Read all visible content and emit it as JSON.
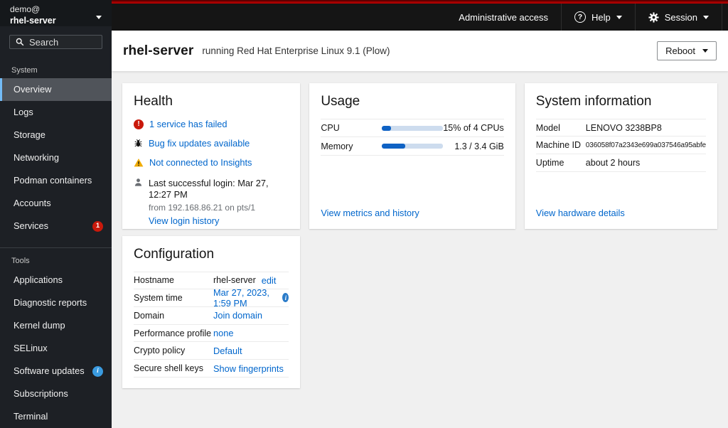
{
  "colors": {
    "brand_red": "#c40000",
    "link_blue": "#0066cc",
    "danger_red": "#c9190b",
    "warning_yellow": "#f0ab00",
    "info_blue": "#2b7cc9",
    "nav_active_accent": "#73bcf7"
  },
  "masthead": {
    "user": "demo@",
    "host": "rhel-server",
    "admin_access_label": "Administrative access",
    "help_label": "Help",
    "session_label": "Session"
  },
  "sidebar": {
    "search_placeholder": "Search",
    "sections": [
      {
        "label": "System",
        "items": [
          {
            "label": "Overview"
          },
          {
            "label": "Logs"
          },
          {
            "label": "Storage"
          },
          {
            "label": "Networking"
          },
          {
            "label": "Podman containers"
          },
          {
            "label": "Accounts"
          },
          {
            "label": "Services",
            "badge": "1"
          }
        ]
      },
      {
        "label": "Tools",
        "items": [
          {
            "label": "Applications"
          },
          {
            "label": "Diagnostic reports"
          },
          {
            "label": "Kernel dump"
          },
          {
            "label": "SELinux"
          },
          {
            "label": "Software updates",
            "badge": "i"
          },
          {
            "label": "Subscriptions"
          },
          {
            "label": "Terminal"
          }
        ]
      }
    ]
  },
  "page_header": {
    "title": "rhel-server",
    "subtitle": "running Red Hat Enterprise Linux 9.1 (Plow)",
    "reboot_label": "Reboot"
  },
  "health": {
    "title": "Health",
    "alerts": [
      {
        "icon": "exclamation-circle-icon",
        "text": "1 service has failed"
      },
      {
        "icon": "bug-icon",
        "text": "Bug fix updates available"
      },
      {
        "icon": "warning-triangle-icon",
        "text": "Not connected to Insights"
      }
    ],
    "last_login": {
      "icon": "user-icon",
      "text": "Last successful login: Mar 27, 12:27 PM",
      "detail": "from 192.168.86.21 on pts/1",
      "link": "View login history"
    }
  },
  "usage": {
    "title": "Usage",
    "rows": [
      {
        "label": "CPU",
        "percent": 15,
        "value": "15% of 4 CPUs"
      },
      {
        "label": "Memory",
        "percent": 38,
        "value": "1.3 / 3.4 GiB"
      }
    ],
    "link": "View metrics and history"
  },
  "system_info": {
    "title": "System information",
    "rows": [
      {
        "label": "Model",
        "value": "LENOVO 3238BP8"
      },
      {
        "label": "Machine ID",
        "value": "036058f07a2343e699a037546a95abfe"
      },
      {
        "label": "Uptime",
        "value": "about 2 hours"
      }
    ],
    "link": "View hardware details"
  },
  "configuration": {
    "title": "Configuration",
    "rows": [
      {
        "label": "Hostname",
        "value": "rhel-server",
        "link": "edit"
      },
      {
        "label": "System time",
        "link": "Mar 27, 2023, 1:59 PM",
        "has_info": true
      },
      {
        "label": "Domain",
        "link": "Join domain"
      },
      {
        "label": "Performance profile",
        "link": "none"
      },
      {
        "label": "Crypto policy",
        "link": "Default"
      },
      {
        "label": "Secure shell keys",
        "link": "Show fingerprints"
      }
    ]
  }
}
